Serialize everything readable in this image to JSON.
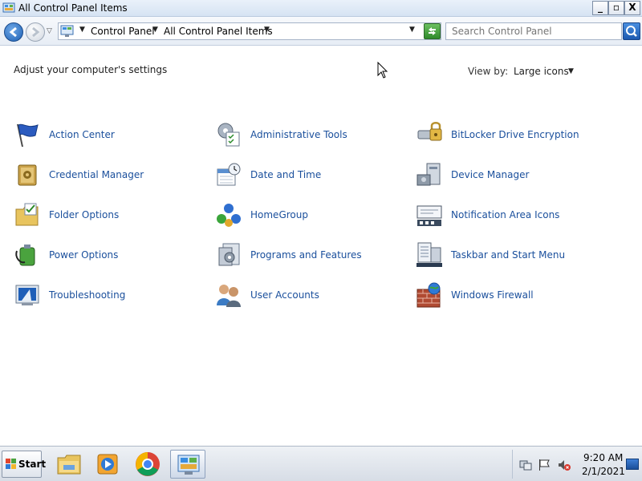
{
  "window": {
    "title": "All Control Panel Items",
    "controls": {
      "minimize": "_",
      "maximize": "▫",
      "close": "X"
    }
  },
  "address_bar": {
    "breadcrumbs": [
      "Control Panel",
      "All Control Panel Items"
    ],
    "search_placeholder": "Search Control Panel"
  },
  "content": {
    "heading": "Adjust your computer's settings",
    "view_by_label": "View by:",
    "view_by_value": "Large icons",
    "items": [
      {
        "label": "Action Center",
        "icon": "action-center-flag-icon"
      },
      {
        "label": "Administrative Tools",
        "icon": "administrative-tools-icon"
      },
      {
        "label": "BitLocker Drive Encryption",
        "icon": "bitlocker-icon"
      },
      {
        "label": "Credential Manager",
        "icon": "credential-manager-icon"
      },
      {
        "label": "Date and Time",
        "icon": "date-time-icon"
      },
      {
        "label": "Device Manager",
        "icon": "device-manager-icon"
      },
      {
        "label": "Folder Options",
        "icon": "folder-options-icon"
      },
      {
        "label": "HomeGroup",
        "icon": "homegroup-icon"
      },
      {
        "label": "Notification Area Icons",
        "icon": "notification-area-icon"
      },
      {
        "label": "Power Options",
        "icon": "power-options-icon"
      },
      {
        "label": "Programs and Features",
        "icon": "programs-features-icon"
      },
      {
        "label": "Taskbar and Start Menu",
        "icon": "taskbar-start-icon"
      },
      {
        "label": "Troubleshooting",
        "icon": "troubleshooting-icon"
      },
      {
        "label": "User Accounts",
        "icon": "user-accounts-icon"
      },
      {
        "label": "Windows Firewall",
        "icon": "windows-firewall-icon"
      }
    ]
  },
  "taskbar": {
    "start_label": "Start",
    "pinned": [
      "file-explorer-icon",
      "media-player-icon",
      "chrome-icon",
      "control-panel-icon"
    ],
    "clock_time": "9:20 AM",
    "clock_date": "2/1/2021"
  },
  "colors": {
    "link": "#1a4f9c",
    "titlebar": "#d6e3f3"
  }
}
